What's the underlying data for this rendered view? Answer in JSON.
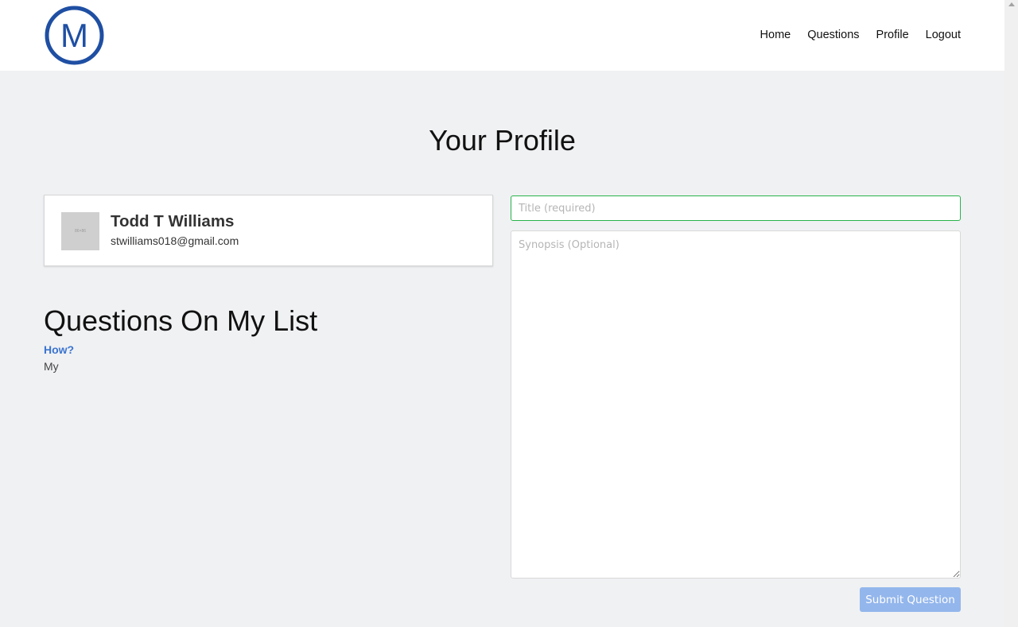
{
  "navbar": {
    "logo_letter": "M",
    "logo_color": "#1f4fa3",
    "links": [
      "Home",
      "Questions",
      "Profile",
      "Logout"
    ]
  },
  "page": {
    "title": "Your Profile"
  },
  "profile": {
    "avatar_text": "86×86",
    "name": "Todd T Williams",
    "email": "stwilliams018@gmail.com"
  },
  "questions": {
    "heading": "Questions On My List",
    "items": [
      {
        "title": "How?",
        "snippet": "My"
      }
    ]
  },
  "form": {
    "title_placeholder": "Title (required)",
    "synopsis_placeholder": "Synopsis (Optional)",
    "submit_label": "Submit Question",
    "title_border_color": "#28b34a",
    "submit_color": "#93b6ec"
  }
}
